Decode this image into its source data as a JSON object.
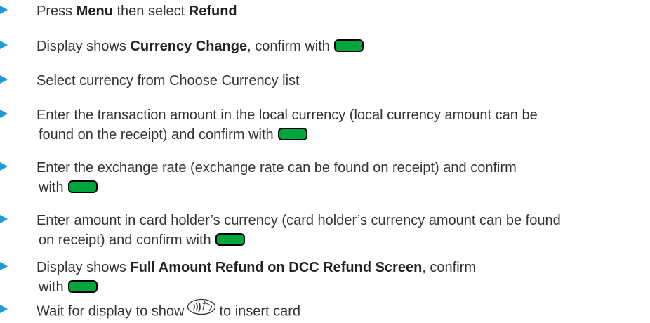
{
  "colors": {
    "bullet": "#1a9ad6",
    "confirm_button": "#00a63c",
    "text": "#333333"
  },
  "icons": {
    "bullet": "triangle-bullet-icon",
    "confirm": "green-ok-button-icon",
    "card": "contactless-card-icon"
  },
  "steps": [
    {
      "pre": "Press ",
      "b1": "Menu",
      "mid": " then select ",
      "b2": "Refund"
    },
    {
      "pre": "Display shows ",
      "b1": "Currency Change",
      "post": ", confirm with"
    },
    {
      "text": "Select currency from Choose Currency list"
    },
    {
      "line1": "Enter the transaction amount in the local currency (local currency amount can be",
      "line2": "found on the receipt) and confirm with"
    },
    {
      "line1": "Enter the exchange rate (exchange rate can be found on receipt) and confirm",
      "line2": "with"
    },
    {
      "line1": "Enter amount in card holder’s currency (card holder’s currency amount can be found",
      "line2": "on receipt) and confirm with"
    },
    {
      "pre": "Display shows ",
      "b1": "Full Amount Refund on DCC Refund Screen",
      "post": ", confirm",
      "line2": "with"
    },
    {
      "pre": "Wait for display to show",
      "post": "to insert card"
    }
  ]
}
